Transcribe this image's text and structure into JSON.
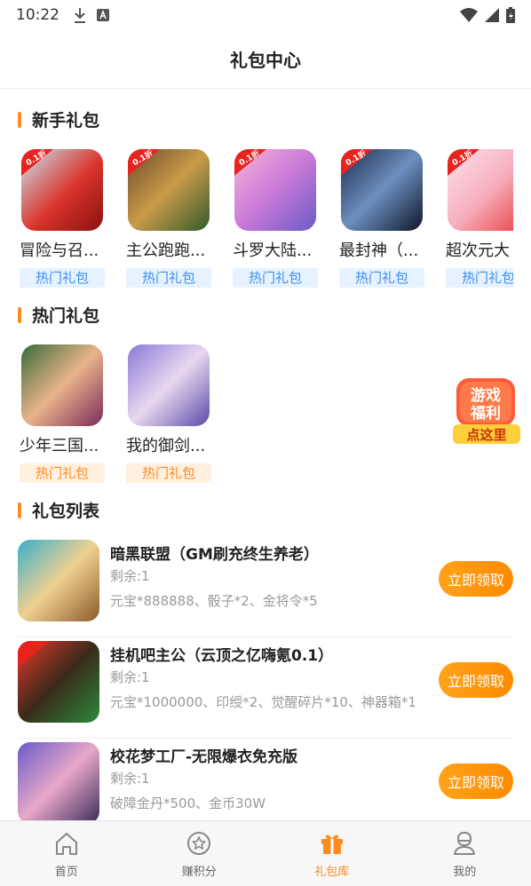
{
  "status": {
    "time": "10:22"
  },
  "header": {
    "title": "礼包中心"
  },
  "sections": {
    "newbie": "新手礼包",
    "hot": "热门礼包",
    "list": "礼包列表"
  },
  "newbie_cards": [
    {
      "name": "冒险与召...",
      "badge": "热门礼包"
    },
    {
      "name": "主公跑跑...",
      "badge": "热门礼包"
    },
    {
      "name": "斗罗大陆...",
      "badge": "热门礼包"
    },
    {
      "name": "最封神（...",
      "badge": "热门礼包"
    },
    {
      "name": "超次元大",
      "badge": "热门礼包"
    }
  ],
  "hot_cards": [
    {
      "name": "少年三国...",
      "badge": "热门礼包"
    },
    {
      "name": "我的御剑...",
      "badge": "热门礼包"
    }
  ],
  "gift_list": [
    {
      "title": "暗黑联盟（GM刷充终生养老）",
      "remain": "剩余:1",
      "reward": "元宝*888888、骰子*2、金将令*5",
      "button": "立即领取"
    },
    {
      "title": "挂机吧主公（云顶之亿嗨氪0.1）",
      "remain": "剩余:1",
      "reward": "元宝*1000000、印绶*2、觉醒碎片*10、神器箱*1",
      "button": "立即领取"
    },
    {
      "title": "校花梦工厂-无限爆衣免充版",
      "remain": "剩余:1",
      "reward": "破障金丹*500、金币30W",
      "button": "立即领取"
    }
  ],
  "float_banner": {
    "line1": "游戏",
    "line2": "福利",
    "line3": "点这里"
  },
  "tabs": [
    {
      "label": "首页",
      "icon": "home-icon"
    },
    {
      "label": "赚积分",
      "icon": "star-coin-icon"
    },
    {
      "label": "礼包库",
      "icon": "gift-icon"
    },
    {
      "label": "我的",
      "icon": "user-icon"
    }
  ],
  "colors": {
    "accent": "#ff8a1f",
    "blue_badge": "#3b8ff0"
  }
}
